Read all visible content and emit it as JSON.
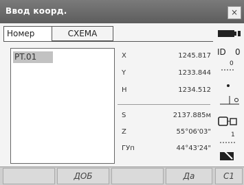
{
  "window": {
    "title": "Ввод коорд.",
    "close_glyph": "×"
  },
  "tabs": [
    {
      "label": "Номер"
    },
    {
      "label": "СХЕМА"
    }
  ],
  "points_list": [
    {
      "label": "PT.01",
      "selected": true
    }
  ],
  "coords": [
    {
      "label": "X",
      "value": "1245.817"
    },
    {
      "label": "Y",
      "value": "1233.844"
    },
    {
      "label": "H",
      "value": "1234.512"
    }
  ],
  "calc": [
    {
      "label": "S",
      "value": "2137.885м"
    },
    {
      "label": "Z",
      "value": "55°06'03\""
    },
    {
      "label": "ГУп",
      "value": "44°43'24\""
    }
  ],
  "side_icons": [
    "battery-icon",
    "prism-constant-icon",
    "target-icon",
    "compensator-icon",
    "laser-icon",
    "signal-icon",
    "keyboard-icon"
  ],
  "softkeys": [
    {
      "label": ""
    },
    {
      "label": "ДОБ"
    },
    {
      "label": ""
    },
    {
      "label": "Да"
    },
    {
      "label": "C1"
    }
  ]
}
